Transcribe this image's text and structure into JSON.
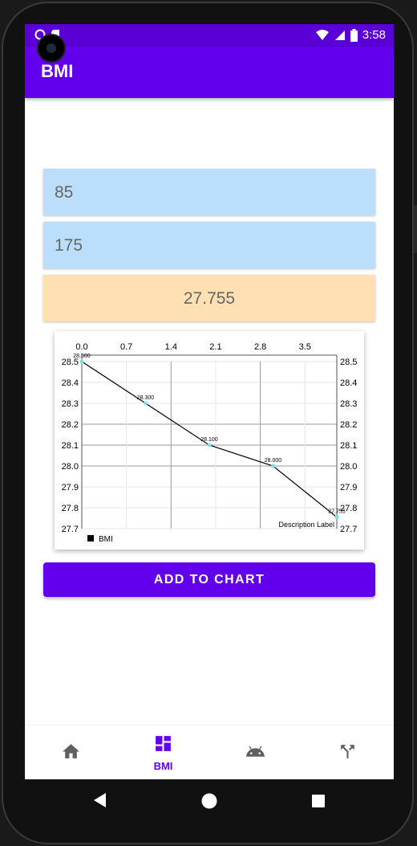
{
  "status_bar": {
    "time": "3:58"
  },
  "app_bar": {
    "title": "BMI"
  },
  "form": {
    "weight_value": "85",
    "height_value": "175",
    "bmi_result": "27.755"
  },
  "chart_data": {
    "type": "line",
    "x": [
      0,
      1,
      2,
      3,
      4
    ],
    "xlim": [
      0,
      4
    ],
    "x_ticks": [
      "0.0",
      "0.7",
      "1.4",
      "2.1",
      "2.8",
      "3.5"
    ],
    "ylim": [
      27.7,
      28.5
    ],
    "y_ticks": [
      "27.7",
      "27.8",
      "27.9",
      "28.0",
      "28.1",
      "28.2",
      "28.3",
      "28.4",
      "28.5"
    ],
    "series": [
      {
        "name": "BMI",
        "values": [
          28.5,
          28.3,
          28.1,
          28.0,
          27.755
        ],
        "labels": [
          "28.500",
          "28.300",
          "28.100",
          "28.000",
          "27.755"
        ],
        "color": "#000000",
        "point_color": "#80deea"
      }
    ],
    "description": "Description Label",
    "legend_position": "bottom-left",
    "grid": true
  },
  "actions": {
    "add_to_chart": "ADD TO CHART"
  },
  "bottom_nav": {
    "items": [
      {
        "label": "",
        "icon": "home-icon"
      },
      {
        "label": "BMI",
        "icon": "dashboard-icon"
      },
      {
        "label": "",
        "icon": "android-icon"
      },
      {
        "label": "",
        "icon": "merge-icon"
      }
    ]
  },
  "colors": {
    "primary": "#6200ee",
    "input_bg": "#bbdefb",
    "result_bg": "#ffe0b2"
  }
}
